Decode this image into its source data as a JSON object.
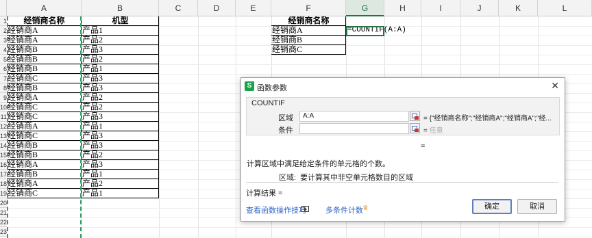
{
  "columns": [
    "A",
    "B",
    "C",
    "D",
    "E",
    "F",
    "G",
    "H",
    "I",
    "J",
    "K",
    "L"
  ],
  "row_numbers": [
    "1",
    "2",
    "3",
    "4",
    "5",
    "6",
    "7",
    "8",
    "9",
    "10",
    "11",
    "12",
    "13",
    "14",
    "15",
    "16",
    "17",
    "18",
    "19",
    "20",
    "21",
    "22",
    "23"
  ],
  "sheet": {
    "a_header": "经销商名称",
    "b_header": "机型",
    "rows": [
      {
        "a": "经销商A",
        "b": "产品1"
      },
      {
        "a": "经销商A",
        "b": "产品2"
      },
      {
        "a": "经销商B",
        "b": "产品3"
      },
      {
        "a": "经销商B",
        "b": "产品2"
      },
      {
        "a": "经销商B",
        "b": "产品1"
      },
      {
        "a": "经销商C",
        "b": "产品3"
      },
      {
        "a": "经销商B",
        "b": "产品3"
      },
      {
        "a": "经销商A",
        "b": "产品2"
      },
      {
        "a": "经销商C",
        "b": "产品2"
      },
      {
        "a": "经销商C",
        "b": "产品3"
      },
      {
        "a": "经销商A",
        "b": "产品1"
      },
      {
        "a": "经销商C",
        "b": "产品3"
      },
      {
        "a": "经销商B",
        "b": "产品3"
      },
      {
        "a": "经销商B",
        "b": "产品2"
      },
      {
        "a": "经销商A",
        "b": "产品3"
      },
      {
        "a": "经销商B",
        "b": "产品1"
      },
      {
        "a": "经销商A",
        "b": "产品2"
      },
      {
        "a": "经销商C",
        "b": "产品1"
      }
    ],
    "f_header": "经销商名称",
    "f_rows": [
      "经销商A",
      "经销商B",
      "经销商C"
    ],
    "g2_formula": "=COUNTIF(A:A)"
  },
  "dialog": {
    "title": "函数参数",
    "close_glyph": "✕",
    "function_name": "COUNTIF",
    "range_label": "区域",
    "range_value": "A:A",
    "range_eq": "= {\"经销商名称\";\"经销商A\";\"经销商A\";\"经...",
    "criteria_label": "条件",
    "criteria_value": "",
    "criteria_eq": "= ",
    "criteria_hint": "任意",
    "result_eq": "=",
    "description": "计算区域中满足给定条件的单元格的个数。",
    "param_desc_label": "区域:",
    "param_desc": "要计算其中非空单元格数目的区域",
    "calc_result_label": "计算结果  =",
    "help_link": "查看函数操作技巧",
    "multi_link": "多条件计数",
    "ok_label": "确定",
    "cancel_label": "取消",
    "icon_letter": "S"
  },
  "colors": {
    "selection_green": "#217346",
    "link_blue": "#2b62c3"
  }
}
